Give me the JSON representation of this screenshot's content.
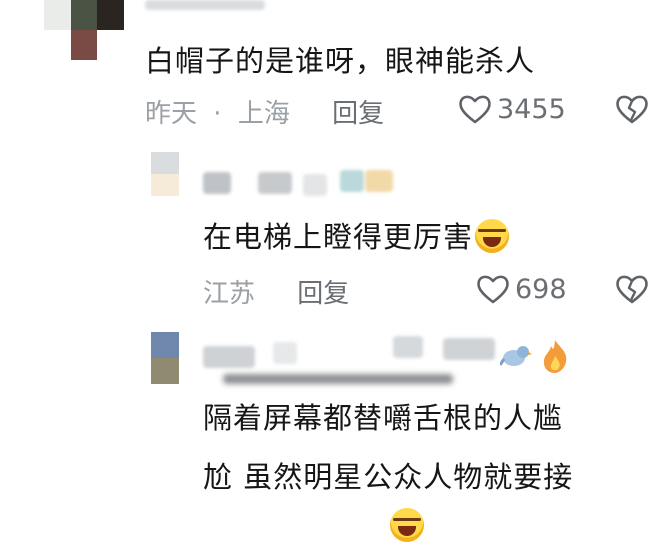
{
  "comments": [
    {
      "text": "白帽子的是谁呀，眼神能杀人",
      "time": "昨天",
      "location": "上海",
      "separator": "·",
      "reply_label": "回复",
      "likes": "3455"
    },
    {
      "text": "在电梯上瞪得更厉害",
      "location": "江苏",
      "reply_label": "回复",
      "likes": "698"
    },
    {
      "text_line1": "隔着屏幕都替嚼舌根的人尴",
      "text_line2": "尬 虽然明星公众人物就要接"
    }
  ],
  "icons": {
    "heart": "heart-outline-icon",
    "dislike": "broken-heart-icon",
    "emoji": "laughing-crying-emoji",
    "fire": "fire-emoji",
    "bird": "bird-emoji"
  }
}
